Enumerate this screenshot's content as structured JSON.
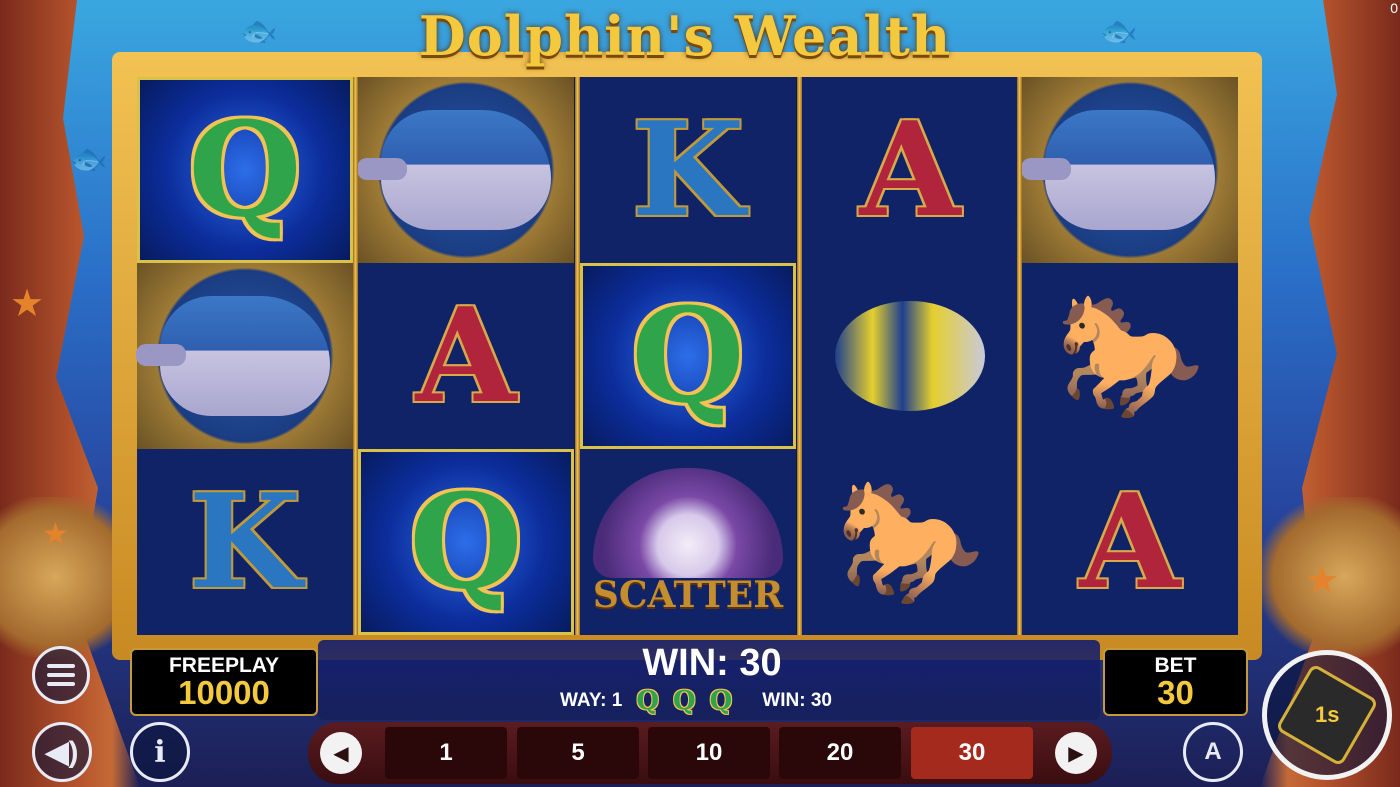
{
  "game": {
    "title": "Dolphin's Wealth",
    "corner_counter": "0"
  },
  "reels": [
    [
      {
        "symbol": "Q",
        "win": true
      },
      {
        "symbol": "dolphin"
      },
      {
        "symbol": "K"
      }
    ],
    [
      {
        "symbol": "dolphin"
      },
      {
        "symbol": "A"
      },
      {
        "symbol": "Q",
        "win": true
      }
    ],
    [
      {
        "symbol": "K"
      },
      {
        "symbol": "Q",
        "win": true
      },
      {
        "symbol": "scatter",
        "label": "SCATTER"
      }
    ],
    [
      {
        "symbol": "A"
      },
      {
        "symbol": "fish"
      },
      {
        "symbol": "seahorse"
      }
    ],
    [
      {
        "symbol": "dolphin"
      },
      {
        "symbol": "seahorse"
      },
      {
        "symbol": "A"
      }
    ]
  ],
  "freeplay": {
    "label": "FREEPLAY",
    "value": "10000"
  },
  "bet": {
    "label": "BET",
    "value": "30"
  },
  "win": {
    "main": "WIN: 30",
    "way_label": "WAY: 1",
    "line_symbols": [
      "Q",
      "Q",
      "Q"
    ],
    "line_win": "WIN: 30"
  },
  "bet_options": [
    "1",
    "5",
    "10",
    "20",
    "30"
  ],
  "selected_bet": "30",
  "controls": {
    "menu": "menu-icon",
    "sound": "speaker-icon",
    "info": "i",
    "auto": "A",
    "spin_label": "1s"
  },
  "colors": {
    "accent_gold": "#f5c93e",
    "selected_bet": "#a52a1e",
    "reel_bg": "#0f2366"
  }
}
